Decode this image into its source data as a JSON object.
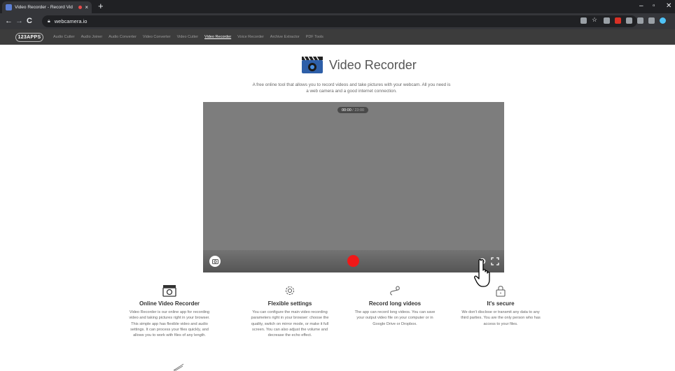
{
  "browser": {
    "tab_title": "Video Recorder - Record Vid",
    "tab_close": "×",
    "new_tab": "+",
    "url": "webcamera.io",
    "window_controls": {
      "minimize": "–",
      "maximize": "▫",
      "close": "✕"
    },
    "nav": {
      "back": "←",
      "forward": "→",
      "reload": "C"
    }
  },
  "site": {
    "logo": "123APPS",
    "nav": [
      "Audio Cutter",
      "Audio Joiner",
      "Audio Converter",
      "Video Converter",
      "Video Cutter",
      "Video Recorder",
      "Voice Recorder",
      "Archive Extractor",
      "PDF Tools"
    ],
    "active_nav": "Video Recorder"
  },
  "hero": {
    "title": "Video Recorder",
    "description": "A free online tool that allows you to record videos and take pictures with your webcam. All you need is a web camera and a good internet connection."
  },
  "player": {
    "time_current": "00:00",
    "time_total": "/ 23:00",
    "accent_color": "#f01818"
  },
  "features": [
    {
      "icon": "camera-icon",
      "title": "Online Video Recorder",
      "text": "Video Recorder is our online app for recording video and taking pictures right in your browser. This simple app has flexible video and audio settings. It can process your files quickly, and allows you to work with files of any length."
    },
    {
      "icon": "gear-icon",
      "title": "Flexible settings",
      "text": "You can configure the main video recording parameters right in your browser: choose the quality, switch on mirror mode, or make it full screen. You can also adjust the volume and decrease the echo effect."
    },
    {
      "icon": "infinity-icon",
      "title": "Record long videos",
      "text": "The app can record long videos. You can save your output video file on your computer or in Google Drive or Dropbox."
    },
    {
      "icon": "lock-icon",
      "title": "It's secure",
      "text": "We don't disclose or transmit any data to any third parties. You are the only person who has access to your files."
    }
  ]
}
